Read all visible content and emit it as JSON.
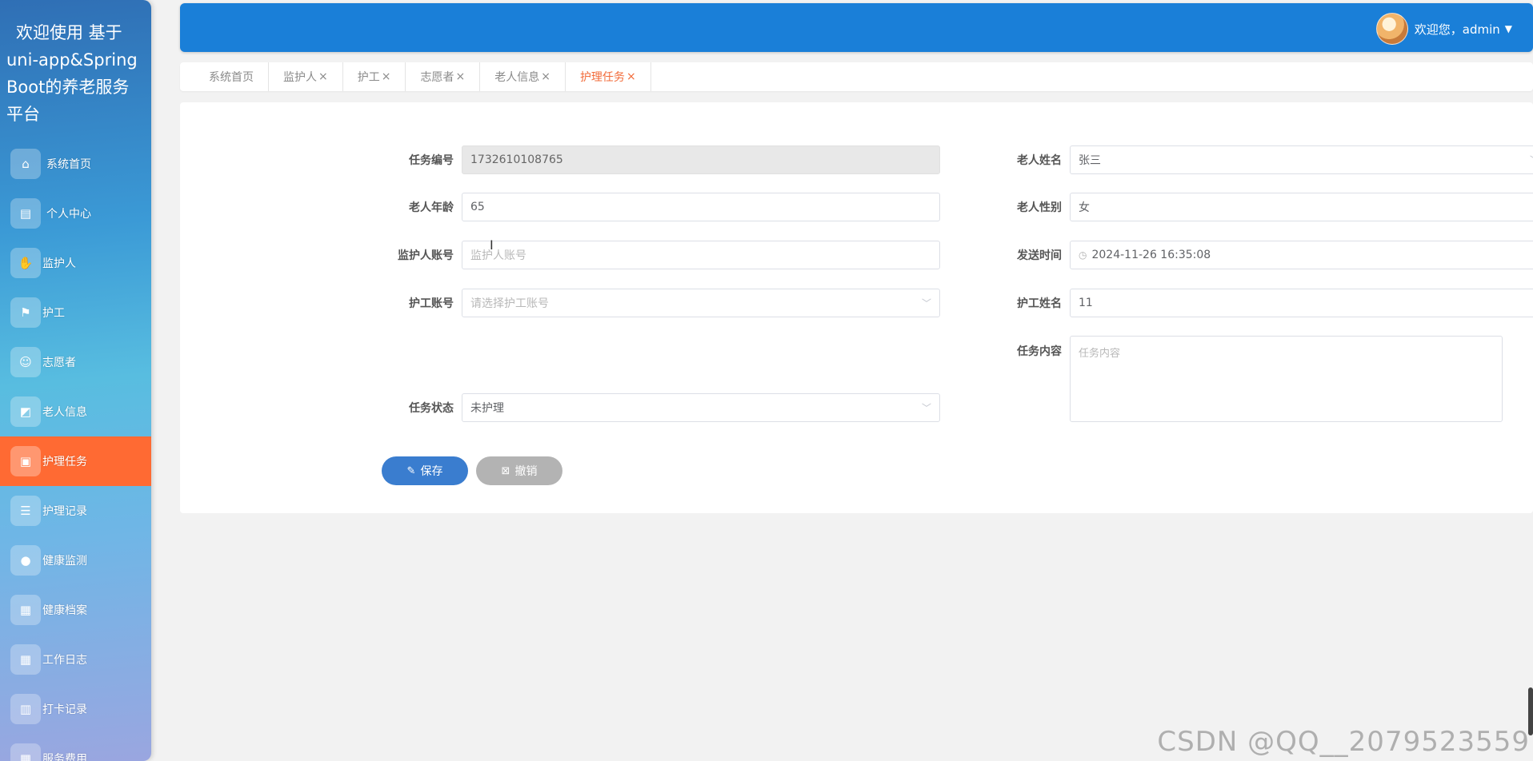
{
  "sidebar": {
    "brand_line1": "欢迎使用 基于",
    "brand_line2": "uni-app&SpringBoot的养老服务平台",
    "items": [
      {
        "label": "系统首页",
        "icon": "home-icon",
        "glyph": "⌂"
      },
      {
        "label": "个人中心",
        "icon": "id-card-icon",
        "glyph": "▤"
      },
      {
        "label": "监护人",
        "icon": "thumb-icon",
        "glyph": "✋"
      },
      {
        "label": "护工",
        "icon": "flag-icon",
        "glyph": "⚑"
      },
      {
        "label": "志愿者",
        "icon": "user-icon",
        "glyph": "☺"
      },
      {
        "label": "老人信息",
        "icon": "chart-icon",
        "glyph": "◩"
      },
      {
        "label": "护理任务",
        "icon": "briefcase-icon",
        "glyph": "▣"
      },
      {
        "label": "护理记录",
        "icon": "list-icon",
        "glyph": "☰"
      },
      {
        "label": "健康监测",
        "icon": "bulb-icon",
        "glyph": "●"
      },
      {
        "label": "健康档案",
        "icon": "grid-icon",
        "glyph": "▦"
      },
      {
        "label": "工作日志",
        "icon": "grid-icon",
        "glyph": "▦"
      },
      {
        "label": "打卡记录",
        "icon": "clipboard-icon",
        "glyph": "▥"
      },
      {
        "label": "服务费用",
        "icon": "grid-icon",
        "glyph": "▦"
      }
    ]
  },
  "header": {
    "greeting": "欢迎您，admin",
    "caret": "▼"
  },
  "tabs": [
    {
      "label": "系统首页",
      "close": ""
    },
    {
      "label": "监护人",
      "close": "×"
    },
    {
      "label": "护工",
      "close": "×"
    },
    {
      "label": "志愿者",
      "close": "×"
    },
    {
      "label": "老人信息",
      "close": "×"
    },
    {
      "label": "护理任务",
      "close": "×"
    }
  ],
  "form": {
    "task_no": {
      "label": "任务编号",
      "value": "1732610108765"
    },
    "elder_name": {
      "label": "老人姓名",
      "value": "张三"
    },
    "elder_age": {
      "label": "老人年龄",
      "value": "65"
    },
    "elder_gender": {
      "label": "老人性别",
      "value": "女"
    },
    "guardian_account": {
      "label": "监护人账号",
      "placeholder": "监护人账号"
    },
    "send_time": {
      "label": "发送时间",
      "value": "2024-11-26 16:35:08"
    },
    "caregiver_account": {
      "label": "护工账号",
      "placeholder": "请选择护工账号"
    },
    "caregiver_name": {
      "label": "护工姓名",
      "value": "11"
    },
    "task_content": {
      "label": "任务内容",
      "placeholder": "任务内容"
    },
    "task_status": {
      "label": "任务状态",
      "value": "未护理"
    },
    "save_label": "保存",
    "cancel_label": "撤销"
  },
  "watermark": "CSDN @QQ__2079523559",
  "colors": {
    "header_blue": "#1a7fd8",
    "active_orange": "#ff6a33",
    "save_blue": "#3a7dcf",
    "cancel_gray": "#b3b3b3"
  }
}
